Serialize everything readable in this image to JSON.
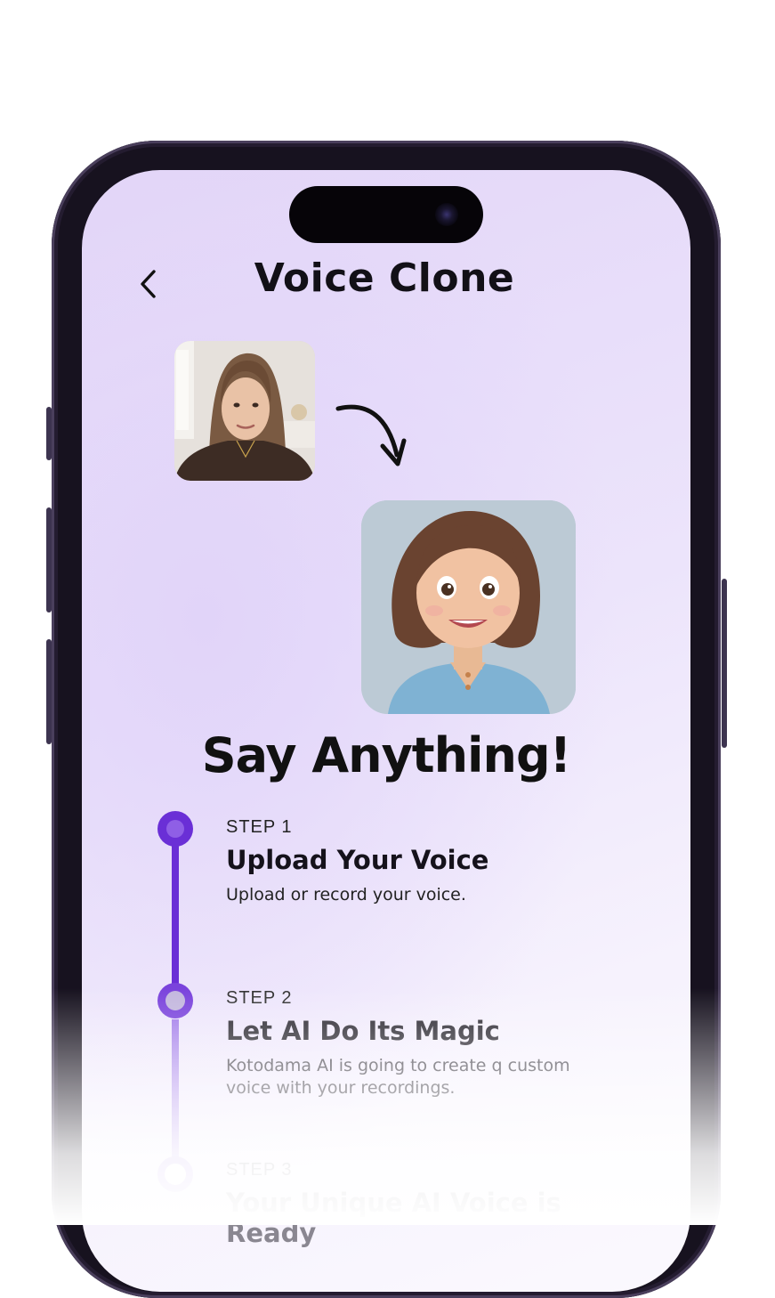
{
  "header": {
    "title": "Voice Clone",
    "back_icon": "chevron-left-icon"
  },
  "media": {
    "source_photo": "woman-photo",
    "arrow_icon": "curved-arrow-icon",
    "result_avatar": "cartoon-avatar"
  },
  "headline": "Say Anything!",
  "steps": [
    {
      "number": "STEP 1",
      "title": "Upload Your Voice",
      "description": "Upload or record your voice.",
      "state": "active"
    },
    {
      "number": "STEP 2",
      "title": "Let AI Do Its Magic",
      "description": "Kotodama AI is going to create q custom voice with your recordings.",
      "state": "pending"
    },
    {
      "number": "STEP 3",
      "title": "Your Unique AI Voice is Ready",
      "description": "",
      "state": "upcoming"
    }
  ],
  "colors": {
    "accent": "#6a2fd6",
    "accent_light": "#b99cf0",
    "screen_bg": "#e9def9",
    "text_dark": "#121017"
  }
}
